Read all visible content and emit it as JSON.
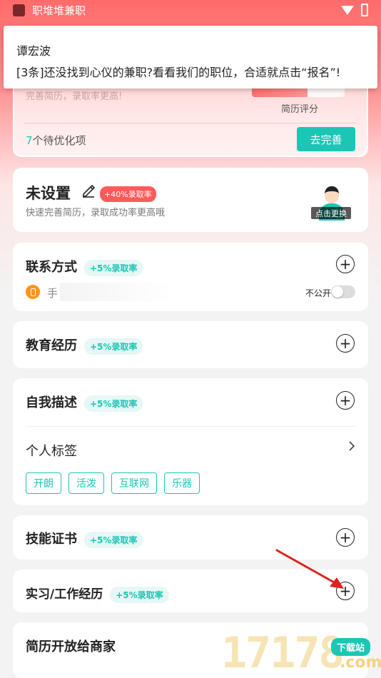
{
  "status": {
    "app_name": "职堆堆兼职"
  },
  "notification": {
    "sender": "谭宏波",
    "message": "[3条]还没找到心仪的兼职?看看我们的职位，合适就点击“报名”!"
  },
  "score_card": {
    "subtitle": "完善简历，录取率更高!",
    "score_label": "简历评分",
    "pending_count": "7",
    "pending_text": "个待优化项",
    "improve_button": "去完善"
  },
  "profile": {
    "name": "未设置",
    "badge": "+40%录取率",
    "description": "快速完善简历，录取成功率更高哦",
    "avatar_label": "点击更换"
  },
  "contact": {
    "title": "联系方式",
    "rate": "+5%录取率",
    "phone_label": "手",
    "public_label": "不公开",
    "public_toggle": false
  },
  "education": {
    "title": "教育经历",
    "rate": "+5%录取率"
  },
  "self_desc": {
    "title": "自我描述",
    "rate": "+5%录取率",
    "tags_title": "个人标签",
    "tags": [
      "开朗",
      "活泼",
      "互联网",
      "乐器"
    ]
  },
  "skills": {
    "title": "技能证书",
    "rate": "+5%录取率"
  },
  "internship": {
    "title": "实习/工作经历",
    "rate": "+5%录取率"
  },
  "open_resume": {
    "title": "简历开放给商家"
  },
  "watermark": {
    "number": "17178",
    "domain": ".com",
    "badge": "下载站"
  },
  "colors": {
    "accent": "#1bc6b4",
    "brand_red": "#ff5a5a",
    "arrow": "#e02020"
  },
  "icons": [
    "wifi-icon",
    "battery-icon",
    "pencil-icon",
    "phone-icon",
    "plus-icon",
    "chevron-right-icon"
  ]
}
